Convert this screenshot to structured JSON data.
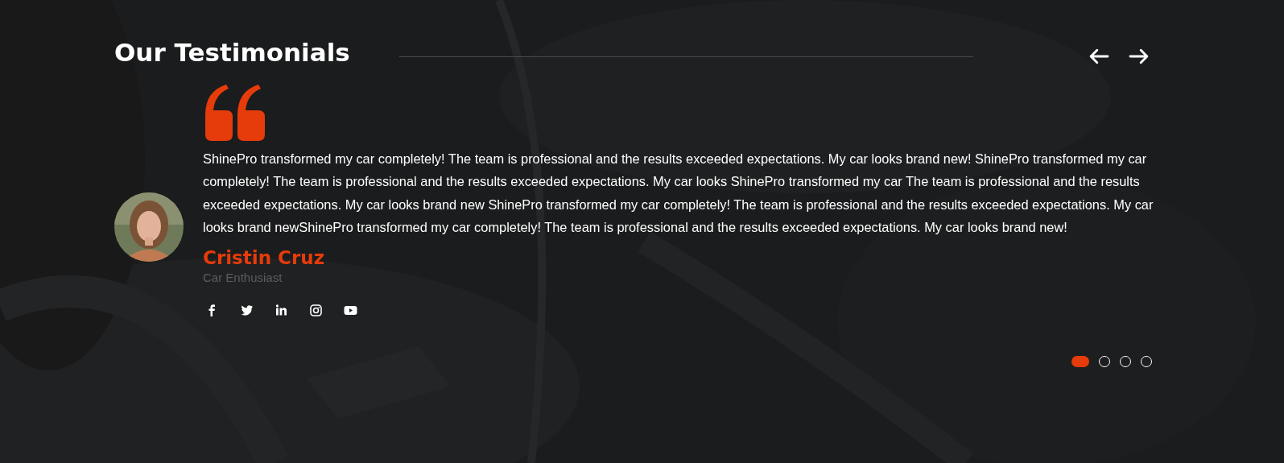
{
  "section": {
    "title": "Our Testimonials"
  },
  "navigation": [
    {
      "kind": "prev"
    },
    {
      "kind": "next"
    }
  ],
  "testimonial": {
    "quote": "ShinePro transformed my car completely! The team is professional and the results exceeded expectations. My car looks brand new! ShinePro transformed my car completely! The team is professional and the results exceeded expectations. My car looks ShinePro transformed my car The team is professional and the results exceeded expectations. My car looks brand new ShinePro transformed my car completely! The team is professional and the results exceeded expectations. My car looks brand newShinePro transformed my car completely! The team is professional and the results exceeded expectations. My car looks brand new!",
    "name": "Cristin Cruz",
    "role": "Car Enthusiast"
  },
  "social_links": [
    {
      "kind": "facebook"
    },
    {
      "kind": "twitter"
    },
    {
      "kind": "linkedin"
    },
    {
      "kind": "instagram"
    },
    {
      "kind": "youtube"
    }
  ],
  "pagination": [
    {
      "selected": true
    },
    {
      "selected": false
    },
    {
      "selected": false
    },
    {
      "selected": false
    }
  ]
}
